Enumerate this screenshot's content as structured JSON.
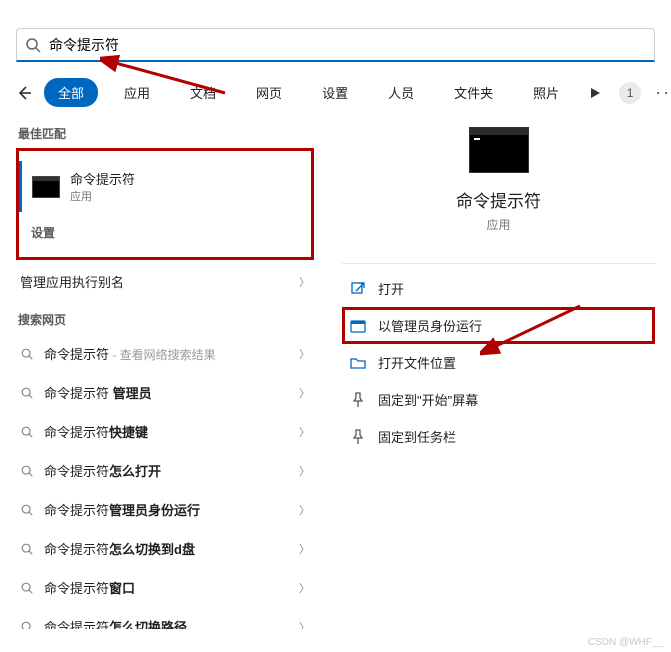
{
  "search": {
    "value": "命令提示符",
    "placeholder": ""
  },
  "tabs": {
    "items": [
      "全部",
      "应用",
      "文档",
      "网页",
      "设置",
      "人员",
      "文件夹",
      "照片"
    ],
    "badge": "1"
  },
  "left": {
    "section_best": "最佳匹配",
    "best_match": {
      "name": "命令提示符",
      "sub": "应用"
    },
    "section_settings": "设置",
    "settings_item": "管理应用执行别名",
    "section_web": "搜索网页",
    "web_items": [
      {
        "term": "命令提示符",
        "hint": " - 查看网络搜索结果",
        "bold": ""
      },
      {
        "term": "命令提示符 ",
        "bold": "管理员",
        "hint": ""
      },
      {
        "term": "命令提示符",
        "bold": "快捷键",
        "hint": ""
      },
      {
        "term": "命令提示符",
        "bold": "怎么打开",
        "hint": ""
      },
      {
        "term": "命令提示符",
        "bold": "管理员身份运行",
        "hint": ""
      },
      {
        "term": "命令提示符",
        "bold": "怎么切换到d盘",
        "hint": ""
      },
      {
        "term": "命令提示符",
        "bold": "窗口",
        "hint": ""
      },
      {
        "term": "命令提示符",
        "bold": "怎么切换路径",
        "hint": ""
      }
    ]
  },
  "right": {
    "name": "命令提示符",
    "sub": "应用",
    "actions": [
      {
        "icon": "open",
        "label": "打开"
      },
      {
        "icon": "admin",
        "label": "以管理员身份运行",
        "highlight": true
      },
      {
        "icon": "folder",
        "label": "打开文件位置"
      },
      {
        "icon": "pin",
        "label": "固定到\"开始\"屏幕"
      },
      {
        "icon": "pin",
        "label": "固定到任务栏"
      }
    ]
  },
  "watermark": "CSDN @WHF__"
}
